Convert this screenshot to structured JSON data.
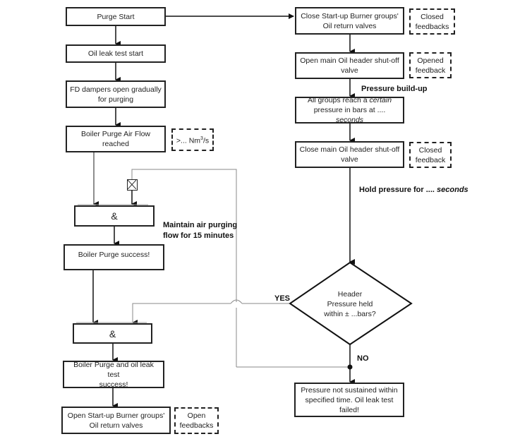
{
  "left_column": {
    "purge_start": "Purge Start",
    "oil_leak_test_start": "Oil leak test start",
    "fd_dampers_line1": "FD dampers open gradually",
    "fd_dampers_line2": "for purging",
    "air_flow_line1": "Boiler Purge Air Flow",
    "air_flow_line2": "reached",
    "air_flow_condition": ">... Nm",
    "air_flow_condition_sup": "3",
    "air_flow_condition_unit": "/s",
    "and_gate_1": "&",
    "maintain_label_line1": "Maintain air purging",
    "maintain_label_line2": "flow for 15 minutes",
    "purge_success": "Boiler Purge success!",
    "and_gate_2": "&",
    "purge_oil_success_line1": "Boiler Purge and oil leak test",
    "purge_oil_success_line2": "success!",
    "open_return_valves_line1": "Open Start-up Burner groups'",
    "open_return_valves_line2": "Oil return valves",
    "open_feedbacks_line1": "Open",
    "open_feedbacks_line2": "feedbacks"
  },
  "right_column": {
    "close_return_valves_line1": "Close Start-up Burner groups'",
    "close_return_valves_line2": "Oil return valves",
    "closed_feedbacks_line1": "Closed",
    "closed_feedbacks_line2": "feedbacks",
    "open_header_valve_line1": "Open main Oil header shut-off",
    "open_header_valve_line2": "valve",
    "opened_feedback_line1": "Opened",
    "opened_feedback_line2": "feedback",
    "pressure_buildup_label": "Pressure build-up",
    "groups_reach_line1_a": "All groups reach a ",
    "groups_reach_line1_b": "certain",
    "groups_reach_line2_a": "pressure in bars at .... ",
    "groups_reach_line2_b": "seconds",
    "close_header_valve_line1": "Close main Oil header shut-off",
    "close_header_valve_line2": "valve",
    "closed_feedback_line1": "Closed",
    "closed_feedback_line2": "feedback",
    "hold_pressure_label_a": "Hold pressure for .... ",
    "hold_pressure_label_b": "seconds",
    "decision_line1": "Header",
    "decision_line2": "Pressure held",
    "decision_line3": "within ± ...bars?",
    "yes_label": "YES",
    "no_label": "NO",
    "failed_line1": "Pressure not sustained within",
    "failed_line2": "specified time. Oil leak test",
    "failed_line3": "failed!"
  }
}
